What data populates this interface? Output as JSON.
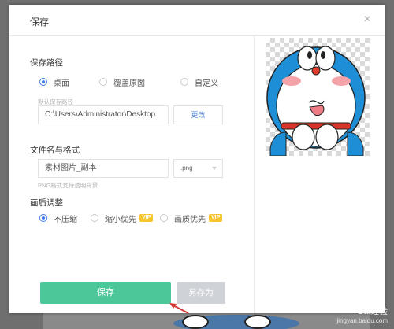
{
  "dialog": {
    "title": "保存",
    "close_glyph": "×"
  },
  "save_path": {
    "label": "保存路径",
    "options": [
      {
        "label": "桌面",
        "selected": true
      },
      {
        "label": "覆盖原图",
        "selected": false
      },
      {
        "label": "自定义",
        "selected": false
      }
    ],
    "default_path_hint": "默认保存路径",
    "path_value": "C:\\Users\\Administrator\\Desktop",
    "change_label": "更改"
  },
  "filename": {
    "label": "文件名与格式",
    "value": "素材图片_副本",
    "format_value": ".png",
    "format_hint": "PNG格式支持透明背景"
  },
  "quality": {
    "label": "画质调整",
    "options": [
      {
        "label": "不压缩",
        "selected": true,
        "vip": false
      },
      {
        "label": "缩小优先",
        "selected": false,
        "vip": true
      },
      {
        "label": "画质优先",
        "selected": false,
        "vip": true
      }
    ],
    "vip_badge": "VIP"
  },
  "actions": {
    "save_label": "保存",
    "save_as_label": "另存为"
  },
  "colors": {
    "primary": "#4cc79a",
    "accent_blue": "#3b7de9",
    "vip": "#f7c52c",
    "disabled": "#cfd2d6"
  },
  "watermark": {
    "brand": "Bai经验",
    "url": "jingyan.baidu.com"
  }
}
